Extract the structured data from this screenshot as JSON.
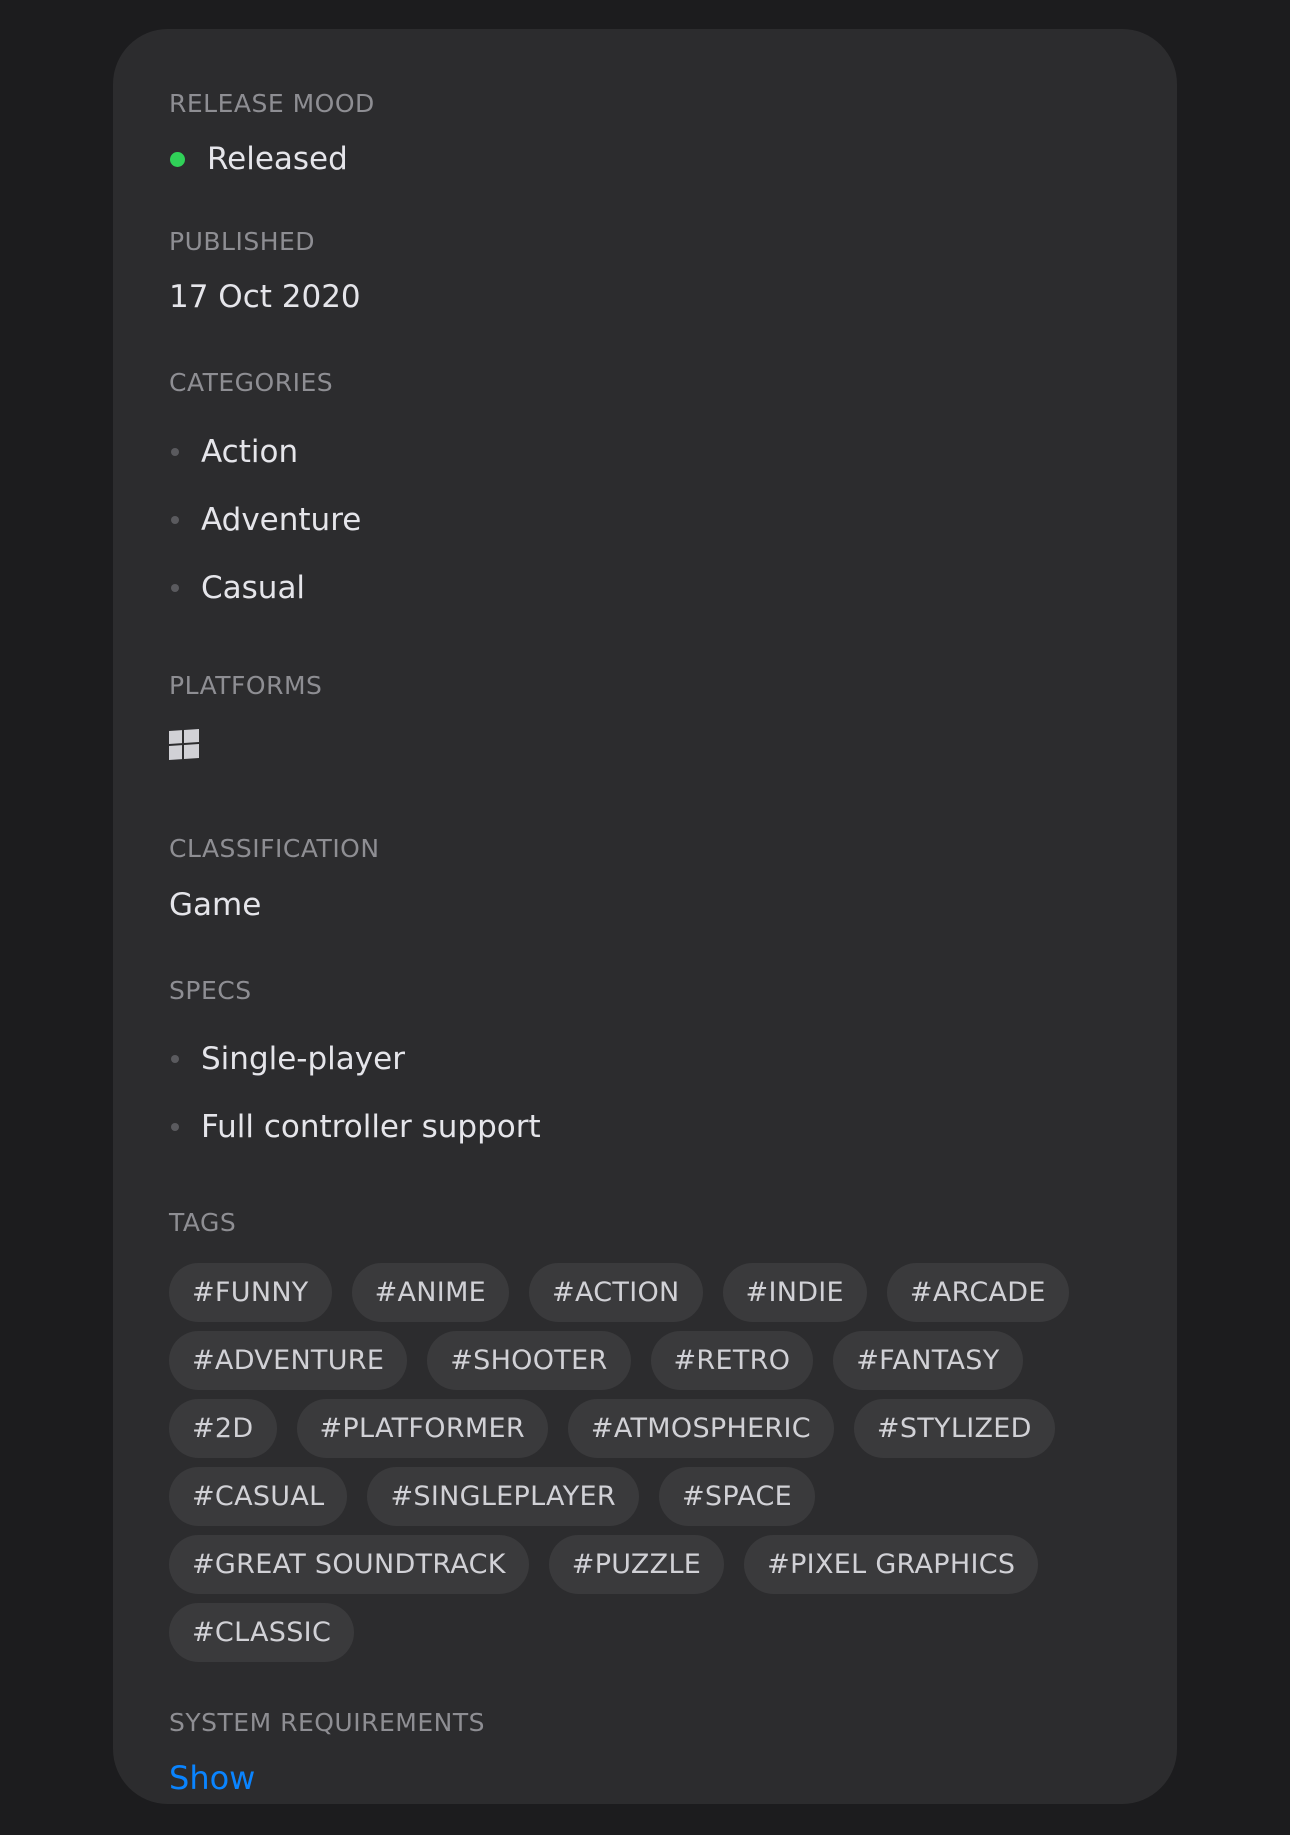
{
  "release_mood": {
    "label": "RELEASE MOOD",
    "value": "Released",
    "status_color": "#30d158"
  },
  "published": {
    "label": "PUBLISHED",
    "value": "17 Oct 2020"
  },
  "categories": {
    "label": "CATEGORIES",
    "items": [
      "Action",
      "Adventure",
      "Casual"
    ]
  },
  "platforms": {
    "label": "PLATFORMS",
    "icons": [
      "windows-icon"
    ]
  },
  "classification": {
    "label": "CLASSIFICATION",
    "value": "Game"
  },
  "specs": {
    "label": "SPECS",
    "items": [
      "Single-player",
      "Full controller support"
    ]
  },
  "tags": {
    "label": "TAGS",
    "items": [
      "#FUNNY",
      "#ANIME",
      "#ACTION",
      "#INDIE",
      "#ARCADE",
      "#ADVENTURE",
      "#SHOOTER",
      "#RETRO",
      "#FANTASY",
      "#2D",
      "#PLATFORMER",
      "#ATMOSPHERIC",
      "#STYLIZED",
      "#CASUAL",
      "#SINGLEPLAYER",
      "#SPACE",
      "#GREAT SOUNDTRACK",
      "#PUZZLE",
      "#PIXEL GRAPHICS",
      "#CLASSIC"
    ]
  },
  "system_requirements": {
    "label": "SYSTEM REQUIREMENTS",
    "link_label": "Show",
    "link_color": "#0a84ff"
  }
}
